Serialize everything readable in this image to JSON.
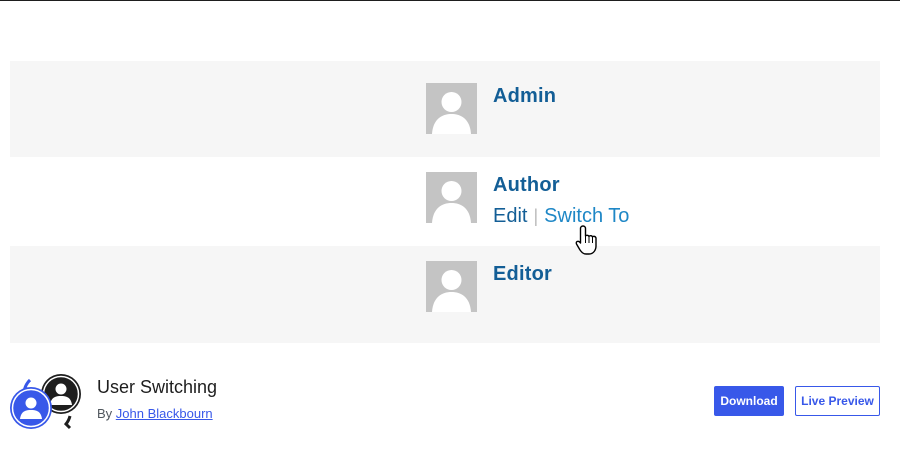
{
  "banner": {
    "rows": [
      {
        "name": "Admin"
      },
      {
        "name": "Author",
        "edit_label": "Edit",
        "separator": "|",
        "switch_label": "Switch To"
      },
      {
        "name": "Editor"
      }
    ]
  },
  "plugin": {
    "title": "User Switching",
    "by_label": "By",
    "author": "John Blackbourn"
  },
  "actions": {
    "download_label": "Download",
    "preview_label": "Live Preview"
  },
  "colors": {
    "accent": "#3858e9",
    "username": "#135e96",
    "link": "#1e87c6",
    "row_gray": "#f6f6f6"
  }
}
